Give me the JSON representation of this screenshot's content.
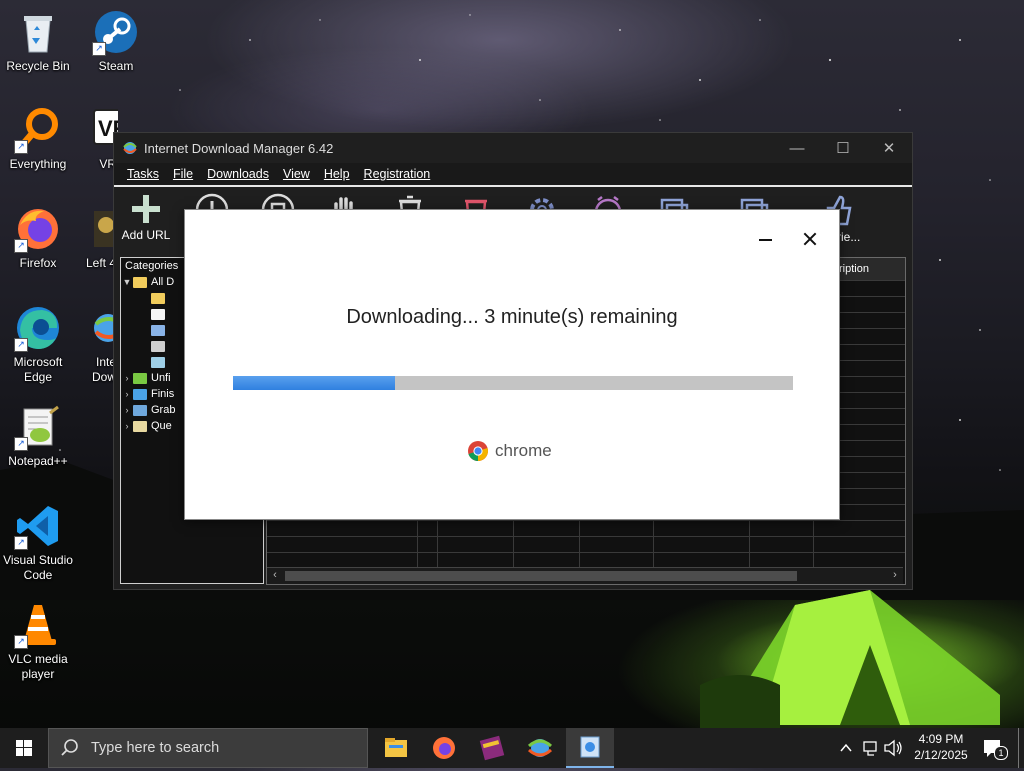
{
  "desktop": {
    "icons": [
      {
        "label": "Recycle Bin",
        "icon": "recycle-bin-icon"
      },
      {
        "label": "Steam",
        "icon": "steam-icon"
      },
      {
        "label": "Everything",
        "icon": "everything-search-icon"
      },
      {
        "label": "VR",
        "icon": "vr-icon"
      },
      {
        "label": "Firefox",
        "icon": "firefox-icon"
      },
      {
        "label": "Left 4",
        "icon": "left4dead-icon"
      },
      {
        "label": "Microsoft Edge",
        "icon": "edge-icon"
      },
      {
        "label": "Inte Dow",
        "icon": "idm-icon"
      },
      {
        "label": "Notepad++",
        "icon": "notepadpp-icon"
      },
      {
        "label": "Visual Studio Code",
        "icon": "vscode-icon"
      },
      {
        "label": "VLC media player",
        "icon": "vlc-icon"
      }
    ],
    "vr_badge_text": "VR"
  },
  "idm": {
    "title": "Internet Download Manager 6.42",
    "menu": [
      "Tasks",
      "File",
      "Downloads",
      "View",
      "Help",
      "Registration"
    ],
    "toolbar": {
      "add_url": "Add URL",
      "tell_friend": "Frie..."
    },
    "categories": {
      "header": "Categories",
      "items": [
        "All D",
        "Unfi",
        "Finis",
        "Grab",
        "Que"
      ]
    },
    "list_header_partial": "ription"
  },
  "download_dialog": {
    "status": "Downloading... 3 minute(s) remaining",
    "progress_fraction": 0.29,
    "brand": "chrome",
    "accent_color": "#2f80e0"
  },
  "taskbar": {
    "search_placeholder": "Type here to search",
    "apps": [
      "file-explorer-icon",
      "firefox-icon",
      "winrar-icon",
      "idm-icon",
      "app-icon"
    ],
    "time": "4:09 PM",
    "date": "2/12/2025",
    "notification_count": "1"
  }
}
